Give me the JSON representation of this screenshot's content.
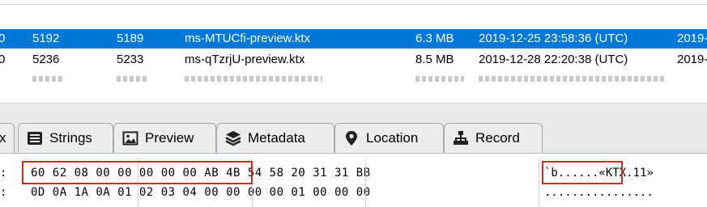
{
  "file_list": {
    "rows": [
      {
        "selected": true,
        "chk": "0",
        "id": "5192",
        "id2": "5189",
        "name": "ms-MTUCfi-preview.ktx",
        "size": "6.3 MB",
        "date": "2019-12-25 23:58:36 (UTC)",
        "more": "2019-"
      },
      {
        "selected": false,
        "chk": "0",
        "id": "5236",
        "id2": "5233",
        "name": "ms-qTzrjU-preview.ktx",
        "size": "8.5 MB",
        "date": "2019-12-28 22:20:38 (UTC)",
        "more": "2019-"
      }
    ]
  },
  "tabs": [
    {
      "label": "x",
      "icon": "close-icon"
    },
    {
      "label": "Strings",
      "icon": "strings-icon"
    },
    {
      "label": "Preview",
      "icon": "image-icon"
    },
    {
      "label": "Metadata",
      "icon": "layers-icon"
    },
    {
      "label": "Location",
      "icon": "location-pin-icon"
    },
    {
      "label": "Record",
      "icon": "sitemap-icon"
    }
  ],
  "hex_view": {
    "rows": [
      {
        "addr": ":",
        "hex": "60 62 08 00 00 00 00 00 AB 4B 54 58 20 31 31 BB",
        "ascii": "`b......«KTX.11»"
      },
      {
        "addr": ":",
        "hex": "0D 0A 1A 0A 01 02 03 04 00 00 00 00 01 00 00 00",
        "ascii": "................"
      }
    ]
  },
  "colors": {
    "selection": "#0078d7",
    "highlight_box": "#d42b1e"
  }
}
